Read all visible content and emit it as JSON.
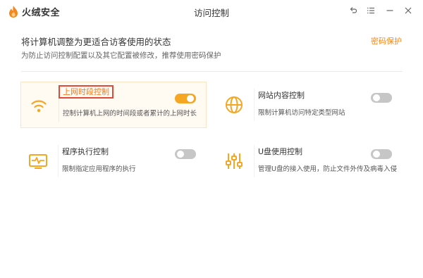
{
  "app": {
    "logo_text": "火绒安全",
    "window_title": "访问控制"
  },
  "header": {
    "title": "将计算机调整为更适合访客使用的状态",
    "subtitle": "为防止访问控制配置以及其它配置被修改，推荐使用密码保护",
    "password_link": "密码保护"
  },
  "cards": [
    {
      "title": "上网时段控制",
      "desc": "控制计算机上网的时间段或者累计的上网时长",
      "enabled": true,
      "icon": "wifi-icon"
    },
    {
      "title": "网站内容控制",
      "desc": "限制计算机访问特定类型网站",
      "enabled": false,
      "icon": "globe-icon"
    },
    {
      "title": "程序执行控制",
      "desc": "限制指定应用程序的执行",
      "enabled": false,
      "icon": "monitor-pulse-icon"
    },
    {
      "title": "U盘使用控制",
      "desc": "管理U盘的接入使用，防止文件外传及病毒入侵",
      "enabled": false,
      "icon": "sliders-icon"
    }
  ],
  "colors": {
    "accent": "#f5871f",
    "icon": "#f5a623",
    "highlight_border": "#e04a3a",
    "toggle_off": "#c6c6c6"
  }
}
